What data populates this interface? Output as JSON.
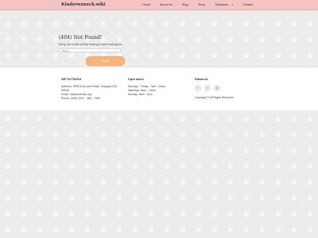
{
  "header": {
    "brand": "Kinderwunsch.wiki",
    "nav": [
      {
        "label": "Home"
      },
      {
        "label": "About Us"
      },
      {
        "label": "Blog"
      },
      {
        "label": "Shop"
      },
      {
        "label": "Thésaisen",
        "chevron": "▾"
      },
      {
        "label": "Contact"
      }
    ]
  },
  "notfound": {
    "title": "(404) Not Found!",
    "subtitle": "Sorry, we could not find what you were looking for.",
    "search_placeholder": "Suche ...",
    "search_button": "Suche"
  },
  "footer": {
    "get_in_touch": {
      "heading": "GET IN TOUCH",
      "lines": [
        "Address: 9995 Wuj Lane Road, Glasgow 204",
        "99040",
        "Email: mail@domain.org",
        "Phone: (999) 0221 - 486 - 7990"
      ]
    },
    "open_hours": {
      "heading": "Open hours",
      "lines": [
        "Monday - Friday : 7am - 10pm",
        "Saturday: 8am - 10pm",
        "Sunday: 8am - 1pm"
      ]
    },
    "follow_us": {
      "heading": "Follow Us",
      "icons": [
        {
          "name": "twitter-icon",
          "glyph": "t"
        },
        {
          "name": "facebook-icon",
          "glyph": "f"
        },
        {
          "name": "linkedin-icon",
          "glyph": "in"
        }
      ],
      "copyright": "Copyright © All Rights Reserved"
    }
  }
}
